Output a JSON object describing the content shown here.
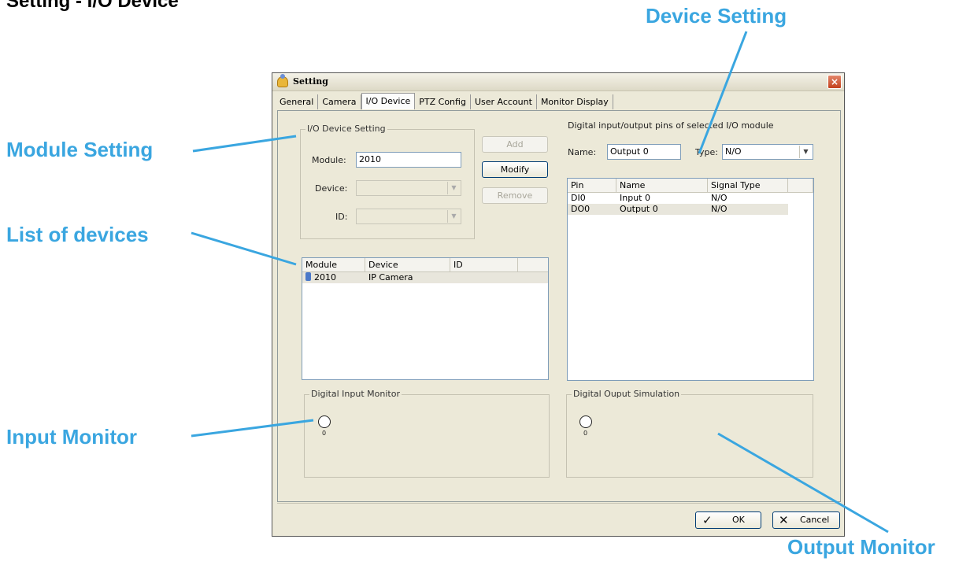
{
  "page": {
    "title": "Setting - I/O Device"
  },
  "callouts": {
    "device_setting": "Device Setting",
    "module_setting": "Module Setting",
    "list_of_devices": "List of devices",
    "input_monitor": "Input Monitor",
    "output_monitor": "Output Monitor",
    "color": "#3aa6e0"
  },
  "dialog": {
    "title": "Setting",
    "close_label": "×",
    "tabs": [
      {
        "label": "General"
      },
      {
        "label": "Camera"
      },
      {
        "label": "I/O Device",
        "active": true
      },
      {
        "label": "PTZ Config"
      },
      {
        "label": "User Account"
      },
      {
        "label": "Monitor Display"
      }
    ],
    "io_device_setting": {
      "title": "I/O Device Setting",
      "module_label": "Module:",
      "module_value": "2010",
      "device_label": "Device:",
      "device_value": "",
      "id_label": "ID:",
      "id_value": ""
    },
    "buttons": {
      "add": "Add",
      "modify": "Modify",
      "remove": "Remove"
    },
    "module_list": {
      "headers": [
        "Module",
        "Device",
        "ID"
      ],
      "rows": [
        {
          "module": "2010",
          "device": "IP Camera",
          "id": "",
          "icon": "camera-icon"
        }
      ]
    },
    "pins": {
      "caption": "Digital input/output pins of selected I/O module",
      "name_label": "Name:",
      "name_value": "Output 0",
      "type_label": "Type:",
      "type_value": "N/O",
      "headers": [
        "Pin",
        "Name",
        "Signal Type"
      ],
      "rows": [
        {
          "pin": "DI0",
          "name": "Input 0",
          "signal": "N/O"
        },
        {
          "pin": "DO0",
          "name": "Output 0",
          "signal": "N/O"
        }
      ]
    },
    "input_monitor": {
      "title": "Digital Input Monitor",
      "indicator_label": "0"
    },
    "output_simulation": {
      "title": "Digital Ouput Simulation",
      "indicator_label": "0"
    },
    "footer": {
      "ok": "OK",
      "cancel": "Cancel"
    }
  }
}
